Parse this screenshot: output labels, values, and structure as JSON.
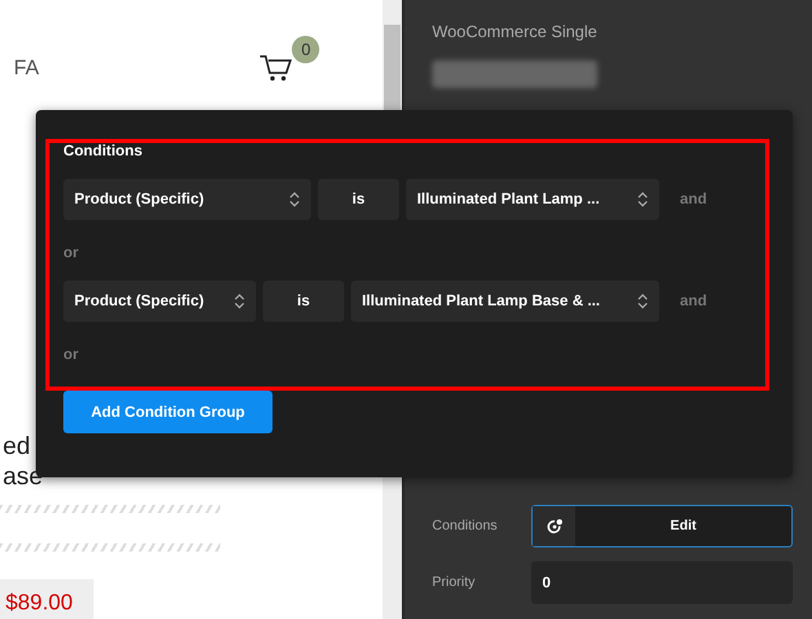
{
  "page": {
    "nav": "FA",
    "cart_count": "0",
    "product_title": [
      "ed",
      "ase"
    ],
    "price": "$89.00"
  },
  "panel": {
    "subtitle": "WooCommerce Single",
    "settings": [
      {
        "kind": "button",
        "label": "Conditions",
        "value": "Edit"
      },
      {
        "kind": "input",
        "label": "Priority",
        "value": "0"
      }
    ]
  },
  "modal": {
    "title": "Conditions",
    "groups": [
      {
        "conditions": [
          {
            "field": "Product (Specific)",
            "operator": "is",
            "value": "Illuminated Plant Lamp ...",
            "connector": "and"
          }
        ],
        "separator": "or"
      },
      {
        "conditions": [
          {
            "field": "Product (Specific)",
            "operator": "is",
            "value": "Illuminated Plant Lamp Base & ...",
            "connector": "and"
          }
        ],
        "separator": "or"
      }
    ],
    "button": "Add Condition Group"
  }
}
